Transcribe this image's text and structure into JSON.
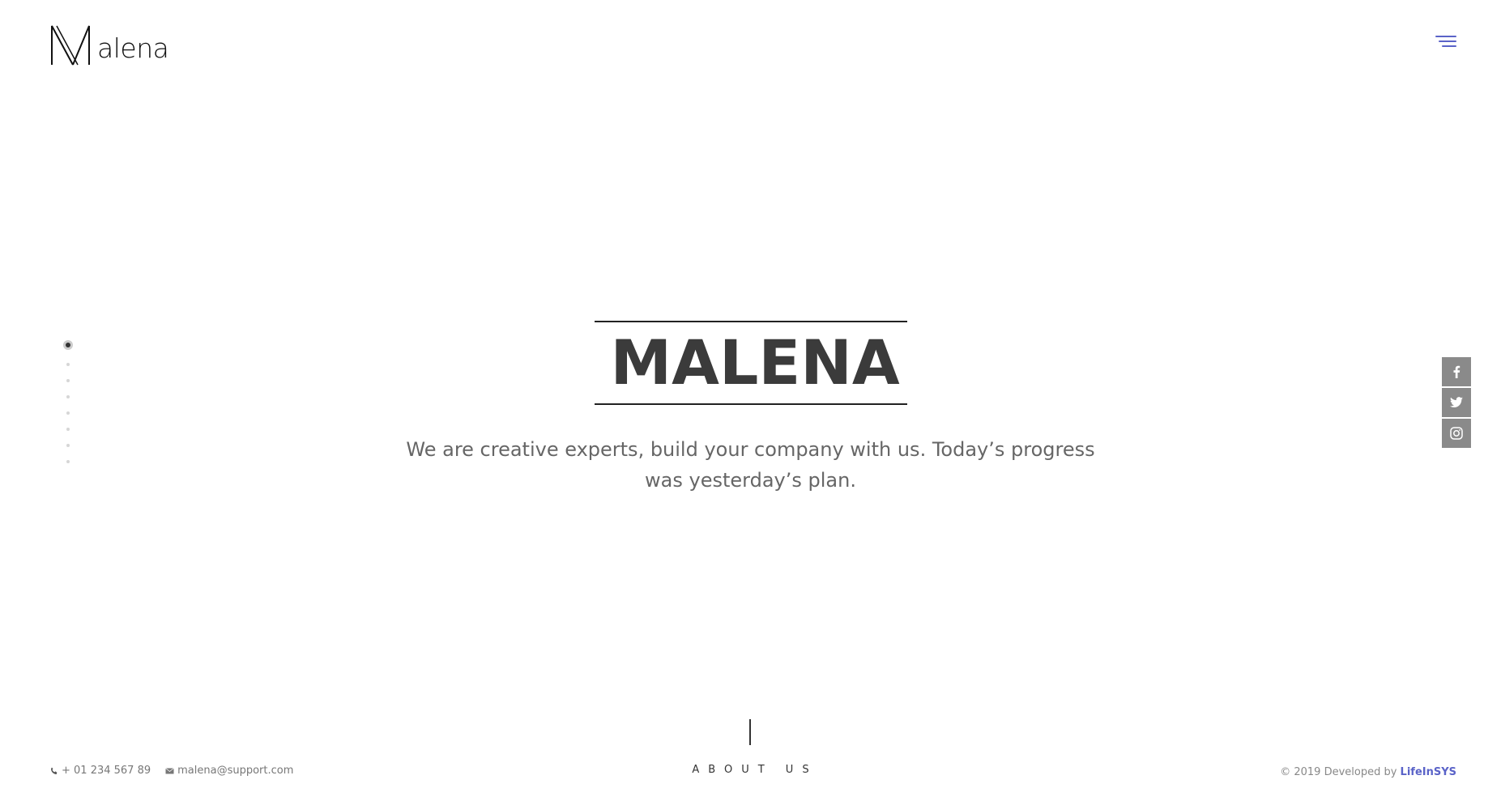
{
  "header": {
    "logo_text": "alena",
    "logo_mark": "M",
    "menu_icon": "hamburger-icon",
    "accent_color": "#5a63c8"
  },
  "side_nav": {
    "total_dots": 8,
    "active_index": 0
  },
  "hero": {
    "title": "MALENA",
    "subtitle": "We are creative experts, build your company with us. Today’s progress was yesterday’s plan."
  },
  "social": [
    {
      "icon": "facebook-icon",
      "label": "f"
    },
    {
      "icon": "twitter-icon",
      "label": "twitter"
    },
    {
      "icon": "instagram-icon",
      "label": "instagram"
    }
  ],
  "scroll": {
    "label": "ABOUT US"
  },
  "footer": {
    "phone": "+ 01 234 567 89",
    "email": "malena@support.com",
    "copyright_prefix": "© 2019 Developed by ",
    "brand": "LifeInSYS"
  }
}
